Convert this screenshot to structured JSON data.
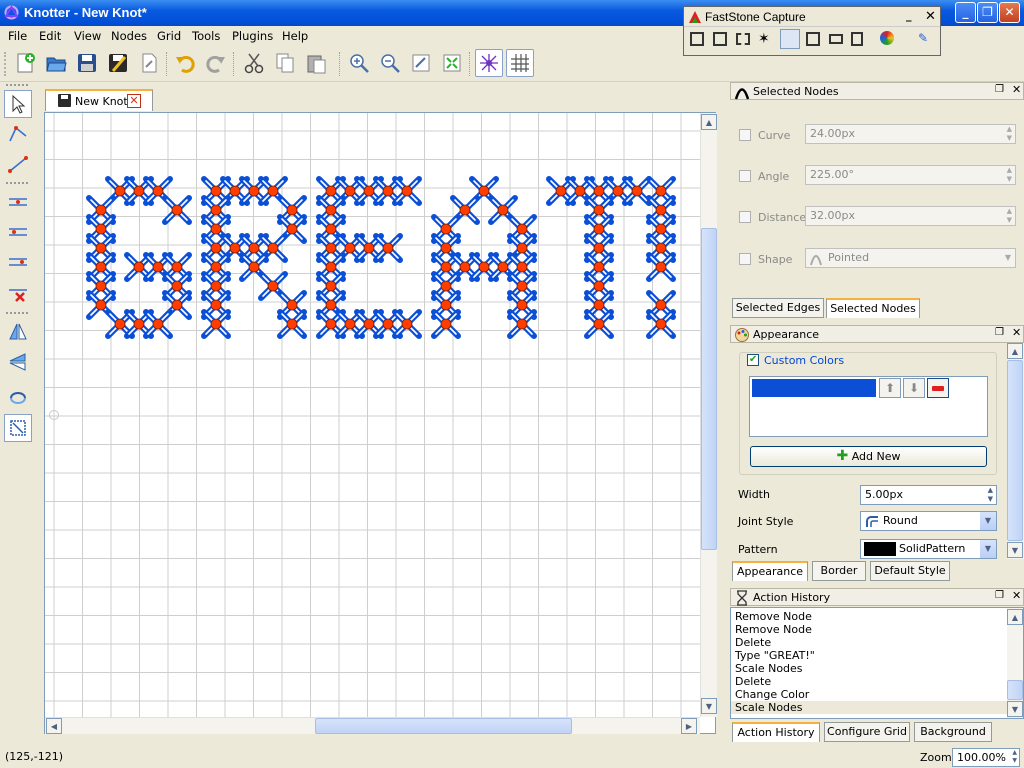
{
  "window": {
    "title": "Knotter - New Knot*"
  },
  "menu": [
    "File",
    "Edit",
    "View",
    "Nodes",
    "Grid",
    "Tools",
    "Plugins",
    "Help"
  ],
  "document_tab": {
    "label": "New Knot"
  },
  "faststone": {
    "title": "FastStone Capture"
  },
  "selected_nodes": {
    "title": "Selected Nodes",
    "curve": {
      "label": "Curve",
      "value": "24.00px"
    },
    "angle": {
      "label": "Angle",
      "value": "225.00°"
    },
    "distance": {
      "label": "Distance",
      "value": "32.00px"
    },
    "shape": {
      "label": "Shape",
      "value": "Pointed"
    },
    "tabs": [
      "Selected Edges",
      "Selected Nodes"
    ]
  },
  "appearance": {
    "title": "Appearance",
    "custom_colors": "Custom Colors",
    "color_entry": "#0a4fd6",
    "add_new": "Add New",
    "width": {
      "label": "Width",
      "value": "5.00px"
    },
    "joint_style": {
      "label": "Joint Style",
      "value": "Round"
    },
    "pattern": {
      "label": "Pattern",
      "value": "SolidPattern"
    },
    "tabs": [
      "Appearance",
      "Border",
      "Default Style"
    ]
  },
  "history": {
    "title": "Action History",
    "items": [
      "Remove Node",
      "Remove Node",
      "Delete",
      "Type \"GREAT!\"",
      "Scale Nodes",
      "Delete",
      "Change Color",
      "Scale Nodes"
    ],
    "tabs": [
      "Action History",
      "Configure Grid",
      "Background"
    ]
  },
  "knot_text": "GREAT!",
  "colors": {
    "knot_stroke": "#0a4fd6",
    "knot_node": "#ff3d00",
    "grid": "#cfcfcf",
    "accent": "#f5b042"
  },
  "status": {
    "coords": "(125,-121)",
    "zoom_label": "Zoom",
    "zoom_value": "100.00%"
  }
}
